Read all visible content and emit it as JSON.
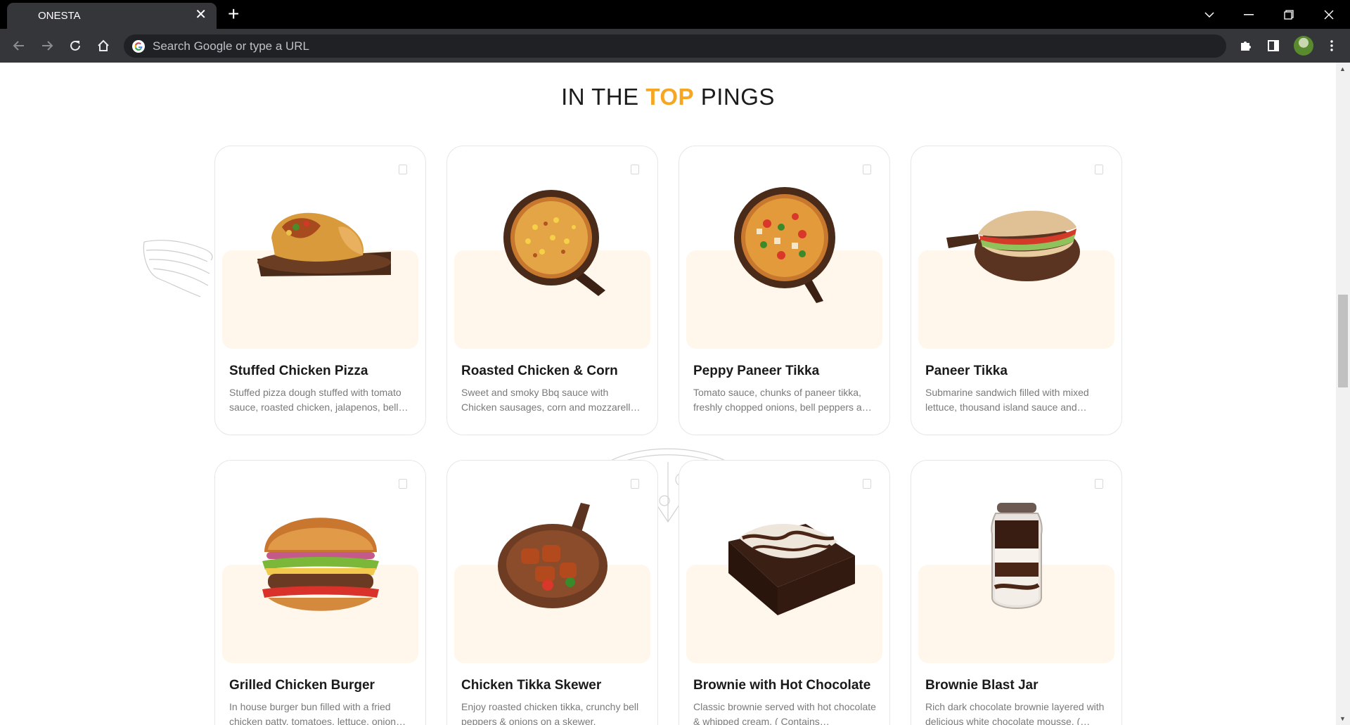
{
  "browser": {
    "tab_title": "ONESTA",
    "tab_close": "✕",
    "new_tab": "+",
    "omnibox_placeholder": "Search Google or type a URL"
  },
  "section": {
    "title_prefix": "IN THE ",
    "title_accent": "TOP",
    "title_suffix": " PINGS",
    "accent_color": "#f5a623"
  },
  "products": [
    {
      "name": "Stuffed Chicken Pizza",
      "desc": "Stuffed pizza dough stuffed with tomato sauce, roasted chicken, jalapenos, bell…",
      "image": "stuffed-pizza"
    },
    {
      "name": "Roasted Chicken & Corn",
      "desc": "Sweet and smoky Bbq sauce with Chicken sausages, corn and mozzarell…",
      "image": "corn-pizza"
    },
    {
      "name": "Peppy Paneer Tikka",
      "desc": "Tomato sauce, chunks of paneer tikka, freshly chopped onions, bell peppers a…",
      "image": "paneer-pizza"
    },
    {
      "name": "Paneer Tikka",
      "desc": "Submarine sandwich filled with mixed lettuce, thousand island sauce and…",
      "image": "sub-sandwich"
    },
    {
      "name": "Grilled Chicken Burger",
      "desc": "In house burger bun filled with a fried chicken patty, tomatoes, lettuce, onion…",
      "image": "burger"
    },
    {
      "name": "Chicken Tikka Skewer",
      "desc": "Enjoy roasted chicken tikka, crunchy bell peppers & onions on a skewer.",
      "image": "tikka"
    },
    {
      "name": "Brownie with Hot Chocolate",
      "desc": "Classic brownie served with hot chocolate & whipped cream. ( Contains…",
      "image": "brownie"
    },
    {
      "name": "Brownie Blast Jar",
      "desc": "Rich dark chocolate brownie layered with delicious white chocolate mousse. (…",
      "image": "brownie-jar"
    }
  ]
}
